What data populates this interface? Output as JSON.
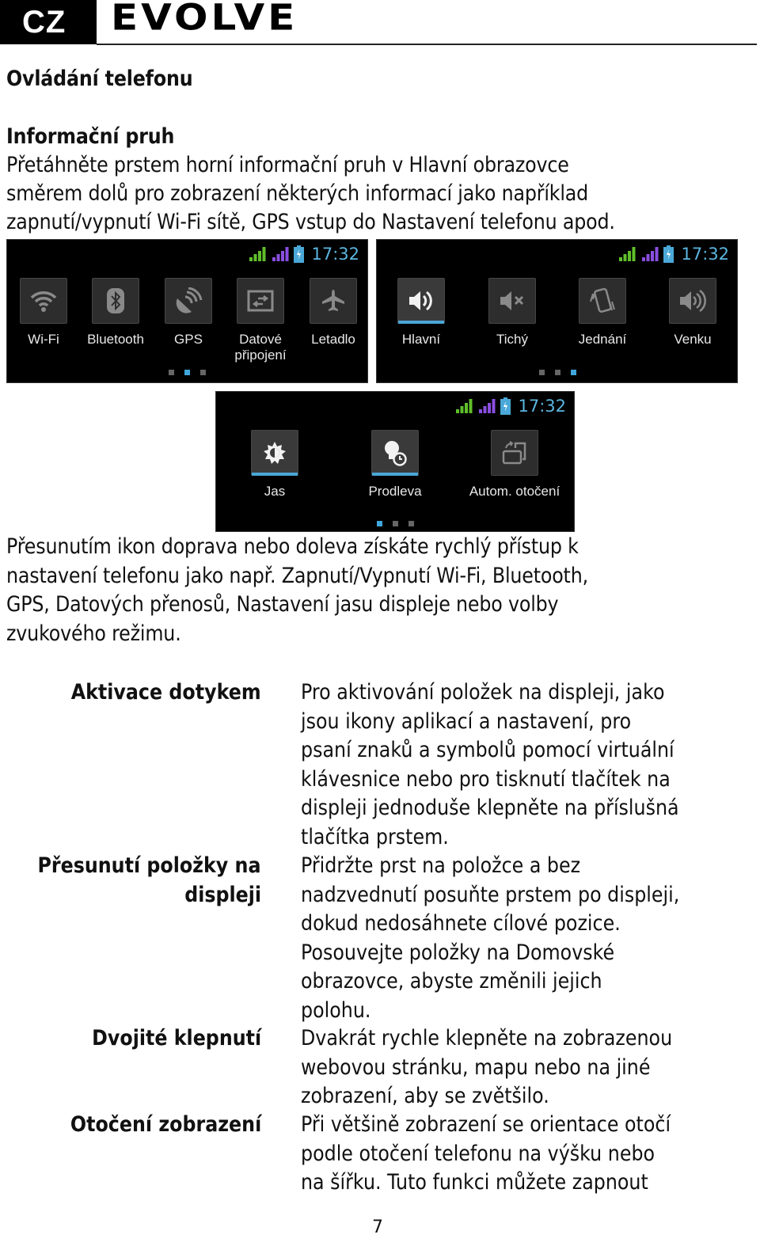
{
  "header": {
    "lang_code": "CZ",
    "brand": "EVOLVE"
  },
  "page_title": "Ovládání telefonu",
  "section": {
    "title": "Informační pruh",
    "intro_lines": [
      "Přetáhněte prstem horní informační pruh v Hlavní obrazovce",
      "směrem dolů pro zobrazení některých informací jako například",
      "zapnutí/vypnutí Wi-Fi sítě, GPS vstup do Nastavení telefonu apod."
    ],
    "after_lines": [
      "Přesunutím ikon doprava nebo doleva získáte rychlý přístup k",
      "nastavení telefonu jako např. Zapnutí/Vypnutí Wi-Fi, Bluetooth,",
      "GPS, Datových přenosů, Nastavení jasu displeje nebo volby",
      "zvukového režimu."
    ]
  },
  "screenshots": [
    {
      "time": "17:32",
      "tiles": [
        {
          "label": "Wi-Fi",
          "icon": "wifi-icon",
          "active": false
        },
        {
          "label": "Bluetooth",
          "icon": "bluetooth-icon",
          "active": false
        },
        {
          "label": "GPS",
          "icon": "gps-icon",
          "active": false
        },
        {
          "label": "Datové",
          "label2": "připojení",
          "icon": "data-connection-icon",
          "active": false
        },
        {
          "label": "Letadlo",
          "icon": "airplane-icon",
          "active": false
        }
      ],
      "page_index": 2,
      "page_count": 3
    },
    {
      "time": "17:32",
      "tiles": [
        {
          "label": "Hlavní",
          "icon": "sound-on-icon",
          "active": true
        },
        {
          "label": "Tichý",
          "icon": "mute-icon",
          "active": false
        },
        {
          "label": "Jednání",
          "icon": "vibrate-icon",
          "active": false
        },
        {
          "label": "Venku",
          "icon": "outdoor-sound-icon",
          "active": false
        }
      ],
      "page_index": 3,
      "page_count": 3
    },
    {
      "time": "17:32",
      "tiles": [
        {
          "label": "Jas",
          "icon": "brightness-icon",
          "active": true
        },
        {
          "label": "Prodleva",
          "icon": "timeout-icon",
          "active": true
        },
        {
          "label": "Autom. otočení",
          "icon": "auto-rotate-icon",
          "active": false
        }
      ],
      "page_index": 1,
      "page_count": 3
    }
  ],
  "status_colors": {
    "signal1": "#5fbf2a",
    "signal2": "#8a4fe0",
    "battery": "#4aa8d8",
    "accent": "#49a6d6"
  },
  "gestures": [
    {
      "label": [
        "Aktivace dotykem"
      ],
      "lines": [
        "Pro aktivování položek na displeji, jako",
        "jsou ikony aplikací a nastavení, pro",
        "psaní znaků a symbolů pomocí virtuální",
        "klávesnice nebo pro tisknutí tlačítek na",
        "displeji jednoduše klepněte na příslušná",
        "tlačítka prstem."
      ]
    },
    {
      "label": [
        "Přesunutí položky na",
        "displeji"
      ],
      "lines": [
        "Přidržte prst na položce a bez",
        "nadzvednutí posuňte prstem po displeji,",
        "dokud nedosáhnete cílové pozice.",
        "Posouvejte položky na Domovské",
        "obrazovce, abyste změnili jejich",
        "polohu."
      ]
    },
    {
      "label": [
        "Dvojité klepnutí"
      ],
      "lines": [
        "Dvakrát rychle klepněte na zobrazenou",
        "webovou stránku, mapu nebo na jiné",
        "zobrazení, aby se zvětšilo."
      ]
    },
    {
      "label": [
        "Otočení zobrazení"
      ],
      "lines": [
        "Při většině zobrazení se orientace otočí",
        "podle otočení telefonu na výšku nebo",
        "na šířku. Tuto funkci můžete zapnout"
      ]
    }
  ],
  "page_number": "7"
}
